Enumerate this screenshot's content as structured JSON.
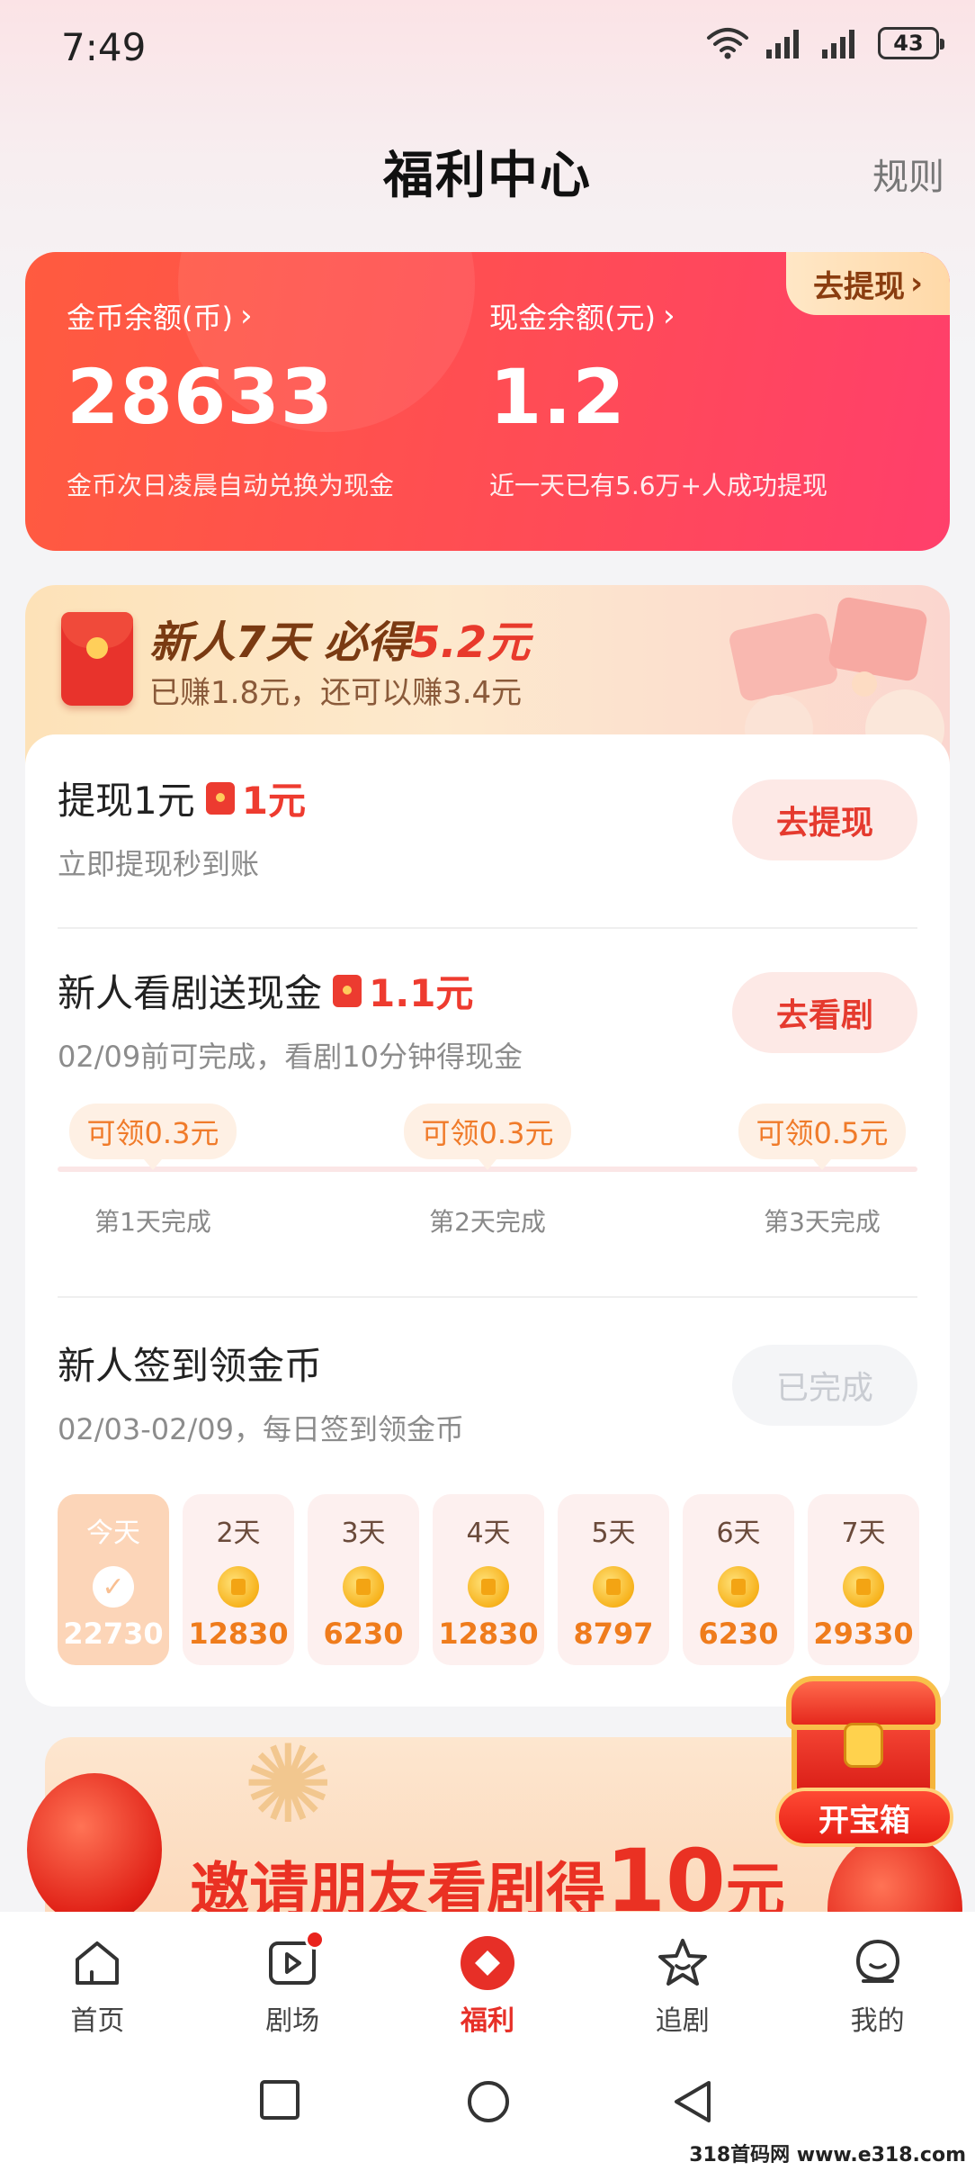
{
  "status_bar": {
    "time": "7:49",
    "battery": "43"
  },
  "header": {
    "title": "福利中心",
    "rules": "规则"
  },
  "balance": {
    "withdraw_tag": "去提现",
    "coins": {
      "label": "金币余额(币)",
      "value": "28633",
      "note": "金币次日凌晨自动兑换为现金"
    },
    "cash": {
      "label": "现金余额(元)",
      "value": "1.2",
      "note": "近一天已有5.6万+人成功提现"
    }
  },
  "promo": {
    "title_part1": "新人7天 必得",
    "title_amount": "5.2元",
    "subtitle": "已赚1.8元，还可以赚3.4元"
  },
  "tasks": {
    "withdraw": {
      "title": "提现1元",
      "reward": "1元",
      "subtitle": "立即提现秒到账",
      "button": "去提现"
    },
    "watch": {
      "title": "新人看剧送现金",
      "reward": "1.1元",
      "subtitle": "02/09前可完成，看剧10分钟得现金",
      "button": "去看剧",
      "milestones": [
        {
          "pill": "可领0.3元",
          "label": "第1天完成"
        },
        {
          "pill": "可领0.3元",
          "label": "第2天完成"
        },
        {
          "pill": "可领0.5元",
          "label": "第3天完成"
        }
      ]
    },
    "signin": {
      "title": "新人签到领金币",
      "subtitle": "02/03-02/09，每日签到领金币",
      "button": "已完成",
      "days": [
        {
          "label": "今天",
          "value": "22730",
          "done": true
        },
        {
          "label": "2天",
          "value": "12830"
        },
        {
          "label": "3天",
          "value": "6230"
        },
        {
          "label": "4天",
          "value": "12830"
        },
        {
          "label": "5天",
          "value": "8797"
        },
        {
          "label": "6天",
          "value": "6230"
        },
        {
          "label": "7天",
          "value": "29330"
        }
      ]
    }
  },
  "invite": {
    "title_text": "邀请朋友看剧得",
    "title_amount": "10",
    "title_unit": "元"
  },
  "treasure": {
    "button": "开宝箱"
  },
  "nav": [
    {
      "label": "首页",
      "icon": "home-icon"
    },
    {
      "label": "剧场",
      "icon": "theater-icon"
    },
    {
      "label": "福利",
      "icon": "welfare-icon"
    },
    {
      "label": "追剧",
      "icon": "star-icon"
    },
    {
      "label": "我的",
      "icon": "profile-icon"
    }
  ],
  "watermark": "318首码网 www.e318.com",
  "colors": {
    "accent": "#e72f27",
    "card_gradient_start": "#ff5b3f",
    "card_gradient_end": "#ff3f6b",
    "coin": "#ef7c1c"
  }
}
